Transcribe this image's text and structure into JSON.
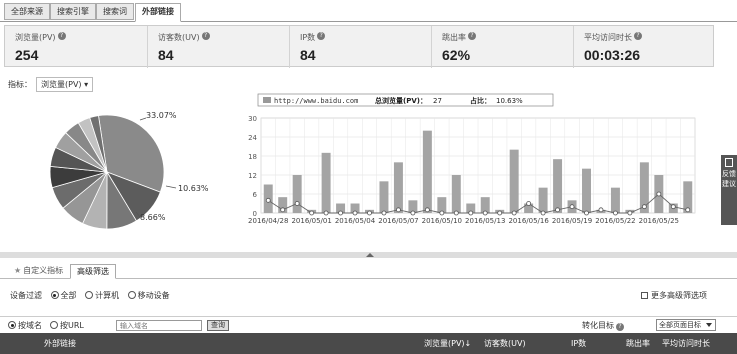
{
  "tabs": [
    {
      "label": "全部来源"
    },
    {
      "label": "搜索引擎"
    },
    {
      "label": "搜索词"
    },
    {
      "label": "外部链接"
    }
  ],
  "metrics": [
    {
      "label": "浏览量(PV)",
      "value": "254"
    },
    {
      "label": "访客数(UV)",
      "value": "84"
    },
    {
      "label": "IP数",
      "value": "84"
    },
    {
      "label": "跳出率",
      "value": "62%"
    },
    {
      "label": "平均访问时长",
      "value": "00:03:26"
    }
  ],
  "indicator": {
    "label": "指标：",
    "value": "浏览量(PV)"
  },
  "pie": {
    "labels": [
      "33.07%",
      "10.63%",
      "8.66%"
    ],
    "slices": [
      33.07,
      10.63,
      8.66,
      7.0,
      7.0,
      6.5,
      6.0,
      5.5,
      5.0,
      4.5,
      3.5,
      2.5
    ],
    "colors": [
      "#8a8a8a",
      "#5c5c5c",
      "#777777",
      "#b3b3b3",
      "#969696",
      "#6c6c6c",
      "#3c3c3c",
      "#555555",
      "#a0a0a0",
      "#888888",
      "#c2c2c2",
      "#707070"
    ]
  },
  "chart_legend": {
    "series_name": "http://www.baidu.com",
    "total_label": "总浏览量(PV)：",
    "total_value": "27",
    "share_label": "占比：",
    "share_value": "10.63%"
  },
  "chart_data": {
    "type": "bar",
    "ylim": [
      0,
      30
    ],
    "yticks": [
      0,
      6,
      12,
      18,
      24,
      30
    ],
    "x_tick_labels": [
      "2016/04/28",
      "2016/05/01",
      "2016/05/04",
      "2016/05/07",
      "2016/05/10",
      "2016/05/13",
      "2016/05/16",
      "2016/05/19",
      "2016/05/22",
      "2016/05/25"
    ],
    "bar_values": [
      9,
      5,
      12,
      1,
      19,
      3,
      3,
      1,
      10,
      16,
      4,
      26,
      5,
      12,
      3,
      5,
      1,
      20,
      3,
      8,
      17,
      4,
      14,
      1,
      8,
      1,
      16,
      12,
      3,
      10
    ],
    "line_values": [
      4,
      1,
      3,
      0,
      0,
      0,
      0,
      0,
      0,
      1,
      0,
      1,
      0,
      0,
      0,
      0,
      0,
      0,
      3,
      0,
      1,
      2,
      0,
      1,
      0,
      0,
      2,
      6,
      2,
      1
    ]
  },
  "subtabs": [
    {
      "label": "自定义指标"
    },
    {
      "label": "高级筛选"
    }
  ],
  "device_filter": {
    "label": "设备过滤",
    "options": [
      "全部",
      "计算机",
      "移动设备"
    ],
    "more": "更多高级筛选项"
  },
  "search_row": {
    "by_domain": "按域名",
    "by_url": "按URL",
    "placeholder": "输入域名",
    "query": "查询",
    "conv_label": "转化目标",
    "conv_value": "全部页面目标"
  },
  "table_head": {
    "col1": "外部链接",
    "col2": "浏览量(PV)",
    "col3": "访客数(UV)",
    "col4": "IP数",
    "col5": "跳出率",
    "col6": "平均访问时长"
  },
  "feedback": {
    "label": "反馈建议"
  }
}
